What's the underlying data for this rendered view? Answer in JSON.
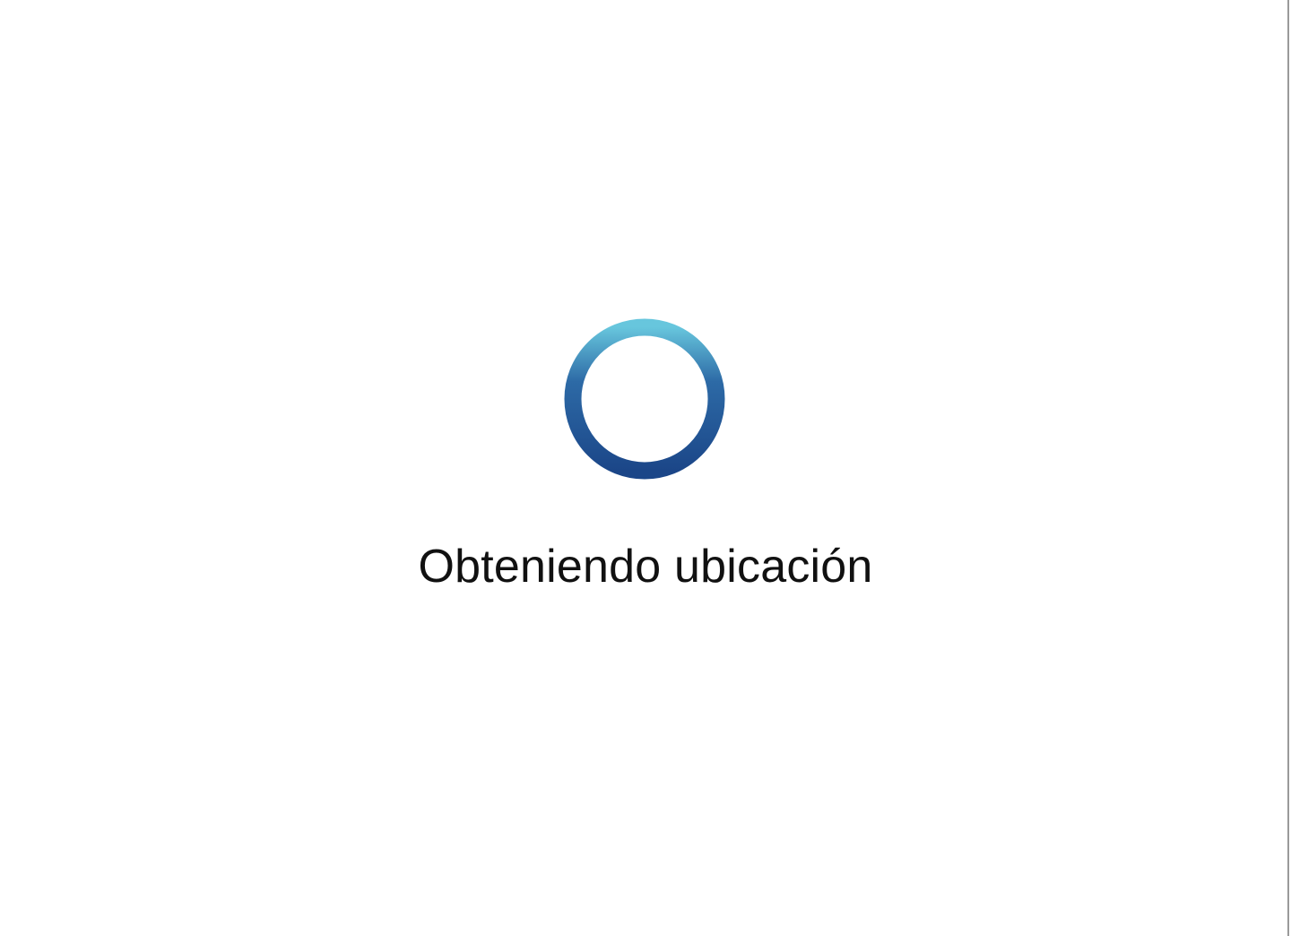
{
  "status": {
    "message": "Obteniendo ubicación"
  },
  "spinner": {
    "icon": "loading-ring-icon",
    "colors": {
      "ring_light": "#67c6dd",
      "ring_mid": "#2d6aa6",
      "ring_dark": "#1b4688"
    }
  },
  "window": {
    "background": "#ffffff",
    "edge_color": "#9a9a9a"
  }
}
